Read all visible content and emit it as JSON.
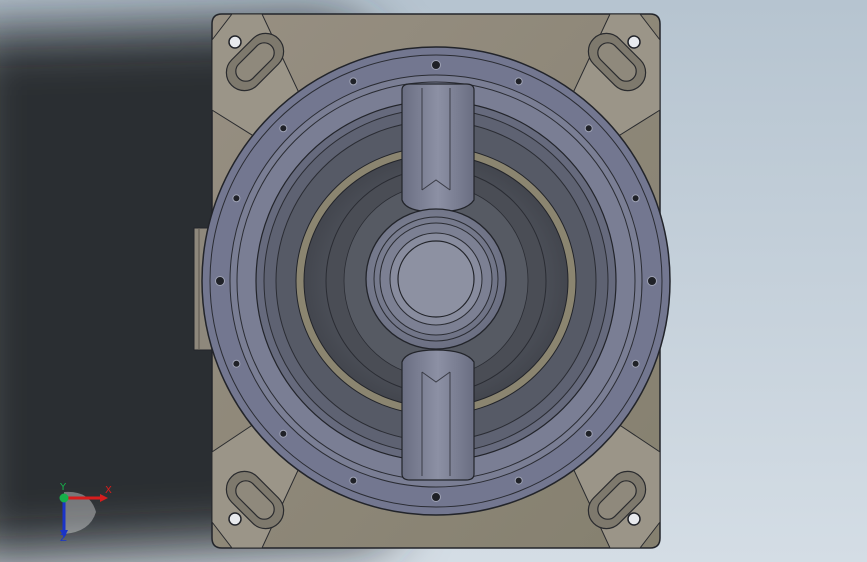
{
  "viewport": {
    "background": {
      "top": "#b3c2cf",
      "bottom": "#d2dbe3",
      "shadow": "#2c3033"
    }
  },
  "model": {
    "name_icon": "gearbox-housing-top-view",
    "colors": {
      "base_plate": "#8c867b",
      "base_plate_light": "#a29c90",
      "flange": "#6e7286",
      "flange_light": "#7b7f94",
      "inner_dark": "#4c5058",
      "inner_mid": "#5b5f69",
      "ring_tan": "#8b8570",
      "edge": "#22242a",
      "boss": "#8f93a6",
      "bridge": "#7d8196"
    }
  },
  "triad": {
    "x_label": "X",
    "y_label": "Y",
    "z_label": "Z",
    "x_color": "#d61d1d",
    "y_color": "#17b04a",
    "z_color": "#1a34c8"
  }
}
